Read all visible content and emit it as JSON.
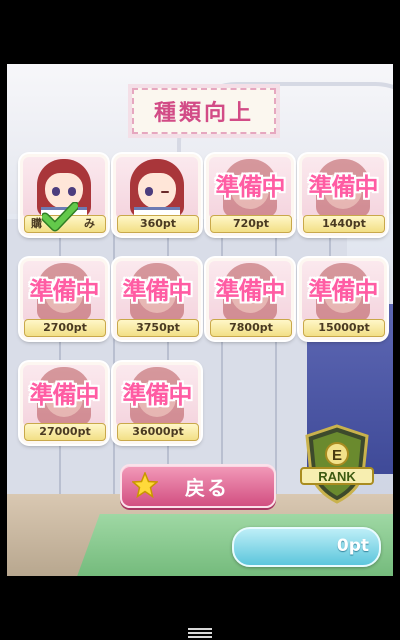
{
  "screen": {
    "title": "種類向上",
    "back_button_label": "戻る",
    "rank_letter": "E",
    "rank_label": "RANK",
    "points": "0pt"
  },
  "cards": [
    {
      "status": "purchased",
      "left_text": "購",
      "right_text": "み",
      "wink": false
    },
    {
      "status": "unlocked",
      "price": "360pt",
      "wink": true
    },
    {
      "status": "locked",
      "label": "準備中",
      "price": "720pt"
    },
    {
      "status": "locked",
      "label": "準備中",
      "price": "1440pt"
    },
    {
      "status": "locked",
      "label": "準備中",
      "price": "2700pt"
    },
    {
      "status": "locked",
      "label": "準備中",
      "price": "3750pt"
    },
    {
      "status": "locked",
      "label": "準備中",
      "price": "7800pt"
    },
    {
      "status": "locked",
      "label": "準備中",
      "price": "15000pt"
    },
    {
      "status": "locked",
      "label": "準備中",
      "price": "27000pt"
    },
    {
      "status": "locked",
      "label": "準備中",
      "price": "36000pt"
    }
  ],
  "colors": {
    "title_text": "#d24b86",
    "locked_text": "#ff5ca3",
    "back_button": "#d24f81",
    "points_box": "#5cc6dc",
    "check": "#4fb43a"
  },
  "icons": [
    "check-icon",
    "star-icon",
    "rank-shield-icon",
    "menu-icon"
  ]
}
